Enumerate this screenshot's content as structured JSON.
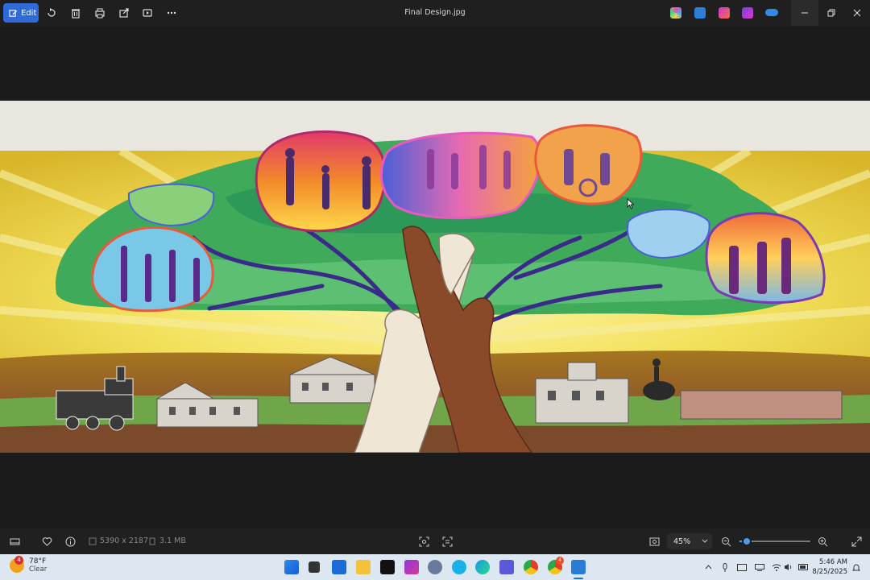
{
  "window": {
    "title": "Final Design.jpg",
    "edit_label": "Edit"
  },
  "toolbar": {
    "icons": [
      "rotate-icon",
      "delete-icon",
      "print-icon",
      "share-icon",
      "slideshow-icon",
      "more-icon"
    ],
    "right_apps": [
      "copilot-icon",
      "photos-editor-icon",
      "clipchamp-icon",
      "designer-icon",
      "onedrive-icon"
    ]
  },
  "image_info": {
    "dimensions": "5390 x 2187",
    "file_size": "3.1 MB"
  },
  "zoom": {
    "value": "45%",
    "level": 0.1
  },
  "weather": {
    "temp": "78°F",
    "condition": "Clear",
    "badge": "4"
  },
  "clock": {
    "time": "5:46 AM",
    "date": "8/25/2025"
  },
  "taskbar": {
    "apps": [
      "start-icon",
      "task-view-icon",
      "store-icon",
      "file-explorer-icon",
      "capcut-icon",
      "clipchamp-icon",
      "settings-icon",
      "skype-icon",
      "edge-icon",
      "teams-icon",
      "chrome-icon",
      "chrome-profile-icon",
      "photos-icon"
    ],
    "notification_badge": "4"
  },
  "colors": {
    "accent": "#2f6bd8",
    "slider": "#4a9be8"
  }
}
